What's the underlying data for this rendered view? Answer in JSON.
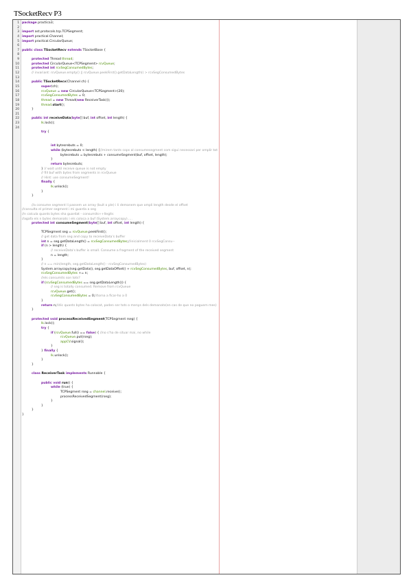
{
  "document": {
    "title": "TSocketRecv P3"
  },
  "colors": {
    "keyword": "#7a1fa2",
    "field": "#4a8a00",
    "comment": "#9a9a9a",
    "default": "#111111",
    "margin_line": "#e9a3a3",
    "gutter_bg": "#f2f2f2",
    "side_panel_bg": "#ececec"
  },
  "lines": [
    {
      "n": "1",
      "i": 0,
      "s": [
        [
          "k",
          "package"
        ],
        [
          "d",
          " practica3;"
        ]
      ]
    },
    {
      "n": "2",
      "i": 0,
      "s": []
    },
    {
      "n": "3",
      "i": 0,
      "s": [
        [
          "k",
          "import"
        ],
        [
          "d",
          " ast.protocols.tcp.TCPSegment;"
        ]
      ]
    },
    {
      "n": "4",
      "i": 0,
      "s": [
        [
          "k",
          "import"
        ],
        [
          "d",
          " practical.Channel;"
        ]
      ]
    },
    {
      "n": "5",
      "i": 0,
      "s": [
        [
          "k",
          "import"
        ],
        [
          "d",
          " practical.CircularQueue;"
        ]
      ]
    },
    {
      "n": "6",
      "i": 0,
      "s": []
    },
    {
      "n": "7",
      "i": 0,
      "s": [
        [
          "k",
          "public class"
        ],
        [
          "b",
          " TSocketRecv "
        ],
        [
          "k",
          "extends"
        ],
        [
          "d",
          " TSocketBase {"
        ]
      ]
    },
    {
      "n": "8",
      "i": 0,
      "s": []
    },
    {
      "n": "9",
      "i": 1,
      "s": [
        [
          "k",
          "protected"
        ],
        [
          "d",
          " Thread "
        ],
        [
          "f",
          "thread"
        ],
        [
          "d",
          ";"
        ]
      ]
    },
    {
      "n": "10",
      "i": 1,
      "s": [
        [
          "k",
          "protected"
        ],
        [
          "d",
          " CircularQueue<TCPSegment> "
        ],
        [
          "f",
          "rcvQueue"
        ],
        [
          "d",
          ";"
        ]
      ]
    },
    {
      "n": "11",
      "i": 1,
      "s": [
        [
          "k",
          "protected int"
        ],
        [
          "d",
          " "
        ],
        [
          "f",
          "rcvSegConsumedBytes"
        ],
        [
          "d",
          ";"
        ]
      ]
    },
    {
      "n": "12",
      "i": 1,
      "s": [
        [
          "c",
          "// invariant: rcvQueue.empty() || rcvQueue.peekFirst().getDataLength() > rcvSegConsumedBytes"
        ]
      ]
    },
    {
      "n": "13",
      "i": 0,
      "s": []
    },
    {
      "n": "14",
      "i": 1,
      "s": [
        [
          "k",
          "public"
        ],
        [
          "b",
          " TSocketRecv"
        ],
        [
          "d",
          "(Channel ch) {"
        ]
      ]
    },
    {
      "n": "15",
      "i": 2,
      "s": [
        [
          "k",
          "super"
        ],
        [
          "d",
          "(ch);"
        ]
      ]
    },
    {
      "n": "16",
      "i": 2,
      "s": [
        [
          "f",
          "rcvQueue"
        ],
        [
          "d",
          " = "
        ],
        [
          "k",
          "new"
        ],
        [
          "d",
          " CircularQueue<TCPSegment>(20);"
        ]
      ]
    },
    {
      "n": "17",
      "i": 2,
      "s": [
        [
          "f",
          "rcvSegConsumedBytes"
        ],
        [
          "d",
          " = 0;"
        ]
      ]
    },
    {
      "n": "18",
      "i": 2,
      "s": [
        [
          "f",
          "thread"
        ],
        [
          "d",
          " = "
        ],
        [
          "k",
          "new"
        ],
        [
          "d",
          " Thread("
        ],
        [
          "k",
          "new"
        ],
        [
          "d",
          " ReceiverTask());"
        ]
      ]
    },
    {
      "n": "19",
      "i": 2,
      "s": [
        [
          "f",
          "thread"
        ],
        [
          "d",
          "."
        ],
        [
          "b",
          "start"
        ],
        [
          "d",
          "();"
        ]
      ]
    },
    {
      "n": "20",
      "i": 1,
      "s": [
        [
          "d",
          "}"
        ]
      ]
    },
    {
      "n": "21",
      "i": 0,
      "s": []
    },
    {
      "n": "22",
      "i": 1,
      "s": [
        [
          "k",
          "public int"
        ],
        [
          "b",
          " receiveData"
        ],
        [
          "d",
          "("
        ],
        [
          "k",
          "byte"
        ],
        [
          "d",
          "[] buf, "
        ],
        [
          "k",
          "int"
        ],
        [
          "d",
          " offset, "
        ],
        [
          "k",
          "int"
        ],
        [
          "d",
          " length) {"
        ]
      ]
    },
    {
      "n": "23",
      "i": 2,
      "s": [
        [
          "f",
          "lk"
        ],
        [
          "d",
          ".lock();"
        ]
      ]
    },
    {
      "n": "24",
      "i": 0,
      "s": []
    },
    {
      "n": "",
      "i": 2,
      "s": [
        [
          "k",
          "try"
        ],
        [
          "d",
          " {"
        ]
      ]
    },
    {
      "n": "",
      "i": 0,
      "s": []
    },
    {
      "n": "",
      "i": 0,
      "s": []
    },
    {
      "n": "",
      "i": 3,
      "s": [
        [
          "k",
          "int"
        ],
        [
          "d",
          " bytesrebuts = 0;"
        ]
      ]
    },
    {
      "n": "",
      "i": 3,
      "s": [
        [
          "k",
          "while"
        ],
        [
          "d",
          " (bytesrebuts < length) {"
        ],
        [
          "c",
          "//mirem tants cops al consumesegment com sigui necessari per omplir tot"
        ]
      ]
    },
    {
      "n": "",
      "i": 4,
      "s": [
        [
          "d",
          "bytesrebuts = bytesrebuts + consumeSegment(buf, offset, length);"
        ]
      ]
    },
    {
      "n": "",
      "i": 3,
      "s": [
        [
          "d",
          "}"
        ]
      ]
    },
    {
      "n": "",
      "i": 3,
      "s": [
        [
          "k",
          "return"
        ],
        [
          "d",
          " bytesrebuts;"
        ]
      ]
    },
    {
      "n": "",
      "i": 2,
      "s": [
        [
          "d",
          "} "
        ],
        [
          "c",
          "// wait until receive queue is not empty"
        ]
      ]
    },
    {
      "n": "",
      "i": 2,
      "s": [
        [
          "c",
          "// fill buf with bytes from segments in rcvQueue"
        ]
      ]
    },
    {
      "n": "",
      "i": 2,
      "s": [
        [
          "c",
          "// Hint: use consumeSegment!"
        ]
      ]
    },
    {
      "n": "",
      "i": 2,
      "s": [
        [
          "k",
          "finally"
        ],
        [
          "d",
          " {"
        ]
      ]
    },
    {
      "n": "",
      "i": 3,
      "s": [
        [
          "f",
          "lk"
        ],
        [
          "d",
          ".unlock();"
        ]
      ]
    },
    {
      "n": "",
      "i": 2,
      "s": [
        [
          "d",
          "}"
        ]
      ]
    },
    {
      "n": "",
      "i": 1,
      "s": [
        [
          "d",
          "}"
        ]
      ]
    },
    {
      "n": "",
      "i": 0,
      "s": []
    },
    {
      "n": "",
      "i": 1,
      "s": [
        [
          "c",
          "//a consume segment li passem un array (buit o ple) i li demanem que ompli length desde el offset"
        ]
      ]
    },
    {
      "n": "",
      "i": 0,
      "s": [
        [
          "c",
          "//consulta el primer segment i mi guarda a seg"
        ]
      ]
    },
    {
      "n": "",
      "i": 0,
      "s": [
        [
          "c",
          "//n calcula quants bytes sha guardat - consumits++llegits"
        ]
      ]
    },
    {
      "n": "",
      "i": 0,
      "s": [
        [
          "c",
          "//agafa els n bytes demanats i els coloca a buf (System.arraycopy)....."
        ]
      ]
    },
    {
      "n": "",
      "i": 1,
      "s": [
        [
          "k",
          "protected int"
        ],
        [
          "b",
          " consumeSegment"
        ],
        [
          "d",
          "("
        ],
        [
          "k",
          "byte"
        ],
        [
          "d",
          "[] buf, "
        ],
        [
          "k",
          "int"
        ],
        [
          "d",
          " offset, "
        ],
        [
          "k",
          "int"
        ],
        [
          "d",
          " length) {"
        ]
      ]
    },
    {
      "n": "",
      "i": 0,
      "s": []
    },
    {
      "n": "",
      "i": 2,
      "s": [
        [
          "d",
          "TCPSegment seg = "
        ],
        [
          "f",
          "rcvQueue"
        ],
        [
          "d",
          ".peekFirst();"
        ]
      ]
    },
    {
      "n": "",
      "i": 2,
      "s": [
        [
          "c",
          "// get data from seg and copy to receiveData's buffer"
        ]
      ]
    },
    {
      "n": "",
      "i": 2,
      "s": [
        [
          "k",
          "int"
        ],
        [
          "d",
          " n = seg.getDataLength() = "
        ],
        [
          "f",
          "rcvSegConsumedBytes"
        ],
        [
          "d",
          ";"
        ],
        [
          "c",
          "//inicialment 0 rcvSegConsu--"
        ]
      ]
    },
    {
      "n": "",
      "i": 2,
      "s": [
        [
          "k",
          "if"
        ],
        [
          "d",
          " (n > length) {"
        ]
      ]
    },
    {
      "n": "",
      "i": 3,
      "s": [
        [
          "c",
          "// receiveData's buffer is small. Consume a fragment of the received segment"
        ]
      ]
    },
    {
      "n": "",
      "i": 3,
      "s": [
        [
          "d",
          "n = length;"
        ]
      ]
    },
    {
      "n": "",
      "i": 2,
      "s": [
        [
          "d",
          "}"
        ]
      ]
    },
    {
      "n": "",
      "i": 2,
      "s": [
        [
          "c",
          "// n == min(length, seg.getDataLength() - rcvSegConsumedBytes)"
        ]
      ]
    },
    {
      "n": "",
      "i": 2,
      "s": [
        [
          "d",
          "System.arraycopy(seg.getData(), seg.getDataOffset() + "
        ],
        [
          "f",
          "rcvSegConsumedBytes"
        ],
        [
          "d",
          ", buf, offset, n);"
        ]
      ]
    },
    {
      "n": "",
      "i": 2,
      "s": [
        [
          "f",
          "rcvSegConsumedBytes"
        ],
        [
          "d",
          " += n;"
        ]
      ]
    },
    {
      "n": "",
      "i": 2,
      "s": [
        [
          "c",
          "//els consumits son tots?"
        ]
      ]
    },
    {
      "n": "",
      "i": 2,
      "s": [
        [
          "k",
          "if"
        ],
        [
          "d",
          " ("
        ],
        [
          "f",
          "rcvSegConsumedBytes"
        ],
        [
          "d",
          " == seg.getDataLength()) {"
        ]
      ]
    },
    {
      "n": "",
      "i": 3,
      "s": [
        [
          "c",
          "// seg is totally consumed. Remove from rcvQueue"
        ]
      ]
    },
    {
      "n": "",
      "i": 3,
      "s": [
        [
          "f",
          "rcvQueue"
        ],
        [
          "d",
          ".get();"
        ]
      ]
    },
    {
      "n": "",
      "i": 3,
      "s": [
        [
          "f",
          "rcvSegConsumedBytes"
        ],
        [
          "d",
          " = 0;"
        ],
        [
          "c",
          "//torna a ficar-ho a 0"
        ]
      ]
    },
    {
      "n": "",
      "i": 2,
      "s": [
        [
          "d",
          "}"
        ]
      ]
    },
    {
      "n": "",
      "i": 2,
      "s": [
        [
          "k",
          "return"
        ],
        [
          "d",
          " n;"
        ],
        [
          "c",
          "//dic quants bytes ha colocat, poden ser tots o menys dels demanats(en cas de que no poguem mes)"
        ]
      ]
    },
    {
      "n": "",
      "i": 1,
      "s": [
        [
          "d",
          "}"
        ]
      ]
    },
    {
      "n": "",
      "i": 0,
      "s": []
    },
    {
      "n": "",
      "i": 1,
      "s": [
        [
          "k",
          "protected void"
        ],
        [
          "b",
          " processReceivedSegment"
        ],
        [
          "d",
          "(TCPSegment rseg) {"
        ]
      ]
    },
    {
      "n": "",
      "i": 2,
      "s": [
        [
          "f",
          "lk"
        ],
        [
          "d",
          ".lock();"
        ]
      ]
    },
    {
      "n": "",
      "i": 2,
      "s": [
        [
          "k",
          "try"
        ],
        [
          "d",
          " {"
        ]
      ]
    },
    {
      "n": "",
      "i": 3,
      "s": [
        [
          "k",
          "if"
        ],
        [
          "d",
          " ("
        ],
        [
          "f",
          "rcvQueue"
        ],
        [
          "d",
          ".full() == "
        ],
        [
          "k",
          "false"
        ],
        [
          "d",
          ") { "
        ],
        [
          "c",
          "//no s'ha de situar mai, no while"
        ]
      ]
    },
    {
      "n": "",
      "i": 4,
      "s": [
        [
          "f",
          "rcvQueue"
        ],
        [
          "d",
          ".put(rseg);"
        ]
      ]
    },
    {
      "n": "",
      "i": 4,
      "s": [
        [
          "f",
          "appCV"
        ],
        [
          "d",
          ".signal();"
        ]
      ]
    },
    {
      "n": "",
      "i": 3,
      "s": [
        [
          "d",
          "}"
        ]
      ]
    },
    {
      "n": "",
      "i": 2,
      "s": [
        [
          "d",
          "} "
        ],
        [
          "k",
          "finally"
        ],
        [
          "d",
          " {"
        ]
      ]
    },
    {
      "n": "",
      "i": 3,
      "s": [
        [
          "f",
          "lk"
        ],
        [
          "d",
          ".unlock();"
        ]
      ]
    },
    {
      "n": "",
      "i": 2,
      "s": [
        [
          "d",
          "}"
        ]
      ]
    },
    {
      "n": "",
      "i": 1,
      "s": [
        [
          "d",
          "}"
        ]
      ]
    },
    {
      "n": "",
      "i": 0,
      "s": []
    },
    {
      "n": "",
      "i": 1,
      "s": [
        [
          "k",
          "class"
        ],
        [
          "b",
          " ReceiverTask "
        ],
        [
          "k",
          "implements"
        ],
        [
          "d",
          " Runnable {"
        ]
      ]
    },
    {
      "n": "",
      "i": 0,
      "s": []
    },
    {
      "n": "",
      "i": 2,
      "s": [
        [
          "k",
          "public void"
        ],
        [
          "b",
          " run"
        ],
        [
          "d",
          "() {"
        ]
      ]
    },
    {
      "n": "",
      "i": 3,
      "s": [
        [
          "k",
          "while"
        ],
        [
          "d",
          " (true) {"
        ]
      ]
    },
    {
      "n": "",
      "i": 4,
      "s": [
        [
          "d",
          "TCPSegment rseg = "
        ],
        [
          "f",
          "channel"
        ],
        [
          "d",
          ".receive();"
        ]
      ]
    },
    {
      "n": "",
      "i": 4,
      "s": [
        [
          "d",
          "processReceivedSegment(rseg);"
        ]
      ]
    },
    {
      "n": "",
      "i": 3,
      "s": [
        [
          "d",
          "}"
        ]
      ]
    },
    {
      "n": "",
      "i": 2,
      "s": [
        [
          "d",
          "}"
        ]
      ]
    },
    {
      "n": "",
      "i": 1,
      "s": [
        [
          "d",
          "}"
        ]
      ]
    },
    {
      "n": "",
      "i": 0,
      "s": [
        [
          "d",
          "}"
        ]
      ]
    }
  ]
}
